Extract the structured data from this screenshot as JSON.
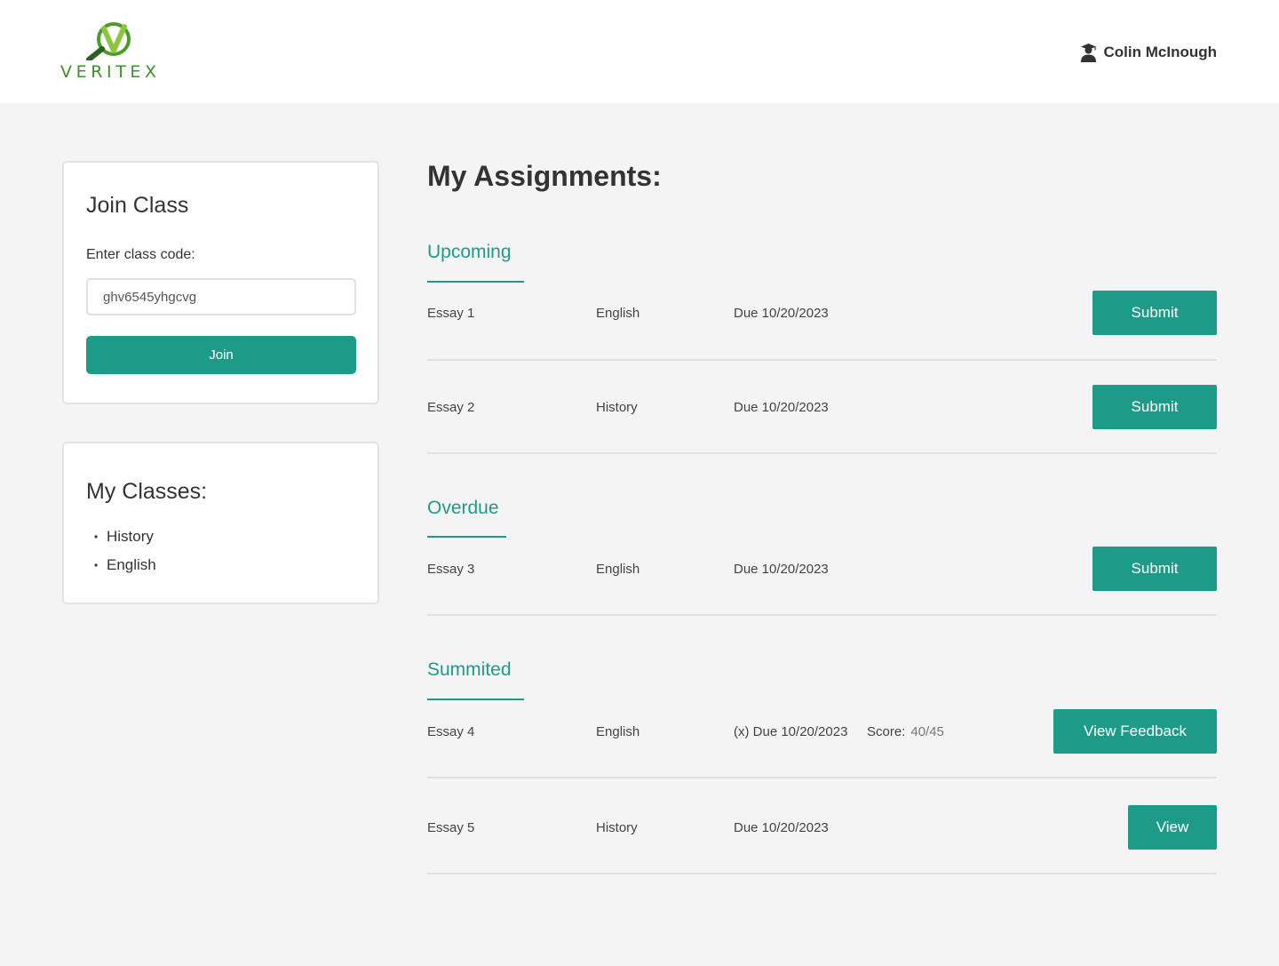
{
  "header": {
    "logo_text": "VERITEX",
    "user_name": "Colin McInough"
  },
  "join_class": {
    "title": "Join Class",
    "label": "Enter class code:",
    "input_value": "ghv6545yhgcvg",
    "button_label": "Join"
  },
  "my_classes": {
    "title": "My Classes:",
    "items": [
      "History",
      "English"
    ]
  },
  "assignments": {
    "title": "My Assignments:",
    "upcoming": {
      "title": "Upcoming",
      "rows": [
        {
          "name": "Essay 1",
          "class": "English",
          "due": "Due 10/20/2023",
          "action": "Submit"
        },
        {
          "name": "Essay 2",
          "class": "History",
          "due": "Due 10/20/2023",
          "action": "Submit"
        }
      ]
    },
    "overdue": {
      "title": "Overdue",
      "rows": [
        {
          "name": "Essay 3",
          "class": "English",
          "due": "Due 10/20/2023",
          "action": "Submit"
        }
      ]
    },
    "submitted": {
      "title": "Summited",
      "rows": [
        {
          "name": "Essay 4",
          "class": "English",
          "due": "(x) Due 10/20/2023",
          "score_label": "Score:",
          "score_value": "40/45",
          "action": "View Feedback"
        },
        {
          "name": "Essay 5",
          "class": "History",
          "due": "Due 10/20/2023",
          "action": "View"
        }
      ]
    }
  },
  "colors": {
    "accent": "#1e9a88",
    "logo_green": "#3f8f2e",
    "background": "#f4f4f4"
  },
  "icons": {
    "user": "user-graduate-icon",
    "logo": "veritex-v-magnifier-logo"
  }
}
